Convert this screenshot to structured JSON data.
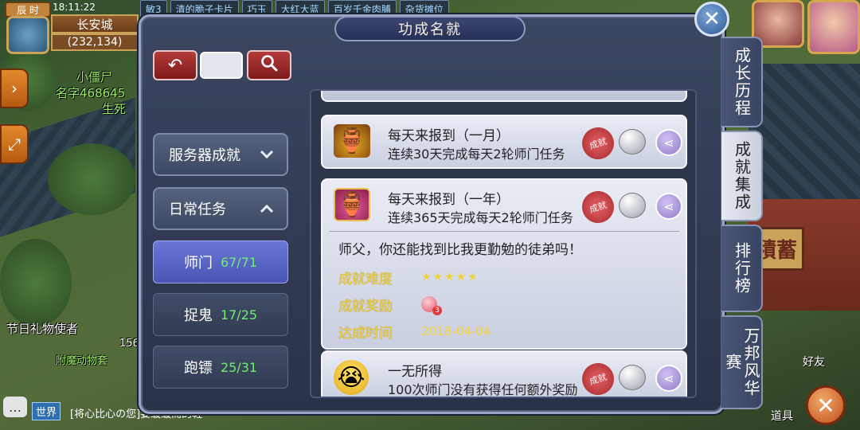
{
  "hud": {
    "time_label": "辰 时",
    "clock": "18:11:22",
    "map_name": "长安城",
    "coords": "(232,134)",
    "top_strip": [
      "敏3",
      "清的脆子卡片",
      "巧玉",
      "大红大蓝",
      "百岁千金肉脯",
      "杂货摊位"
    ]
  },
  "world": {
    "npc_small_zombie": "小僵尸",
    "npc_name_prefix": "名字468645",
    "npc_misc": "生死",
    "npc_gift": "节日礼物使者",
    "npc_pet": "附魔动物套",
    "npc_156": "156",
    "building_sign": "積蓄",
    "friend_label": "好友",
    "tool_label": "道具",
    "chat_world": "世界",
    "chat_text": "[将心比心の您]要缓缓而的鞋"
  },
  "dialog": {
    "title": "功成名就",
    "close_label": "✕",
    "back_icon": "↶",
    "search_icon": "🔍",
    "search_placeholder": ""
  },
  "sidebar": {
    "groups": [
      {
        "label": "服务器成就",
        "chevron": "⌄"
      },
      {
        "label": "日常任务",
        "chevron": "⌃"
      }
    ],
    "items": [
      {
        "label": "师门",
        "count": "67/71",
        "active": true
      },
      {
        "label": "捉鬼",
        "count": "17/25",
        "active": false
      },
      {
        "label": "跑镖",
        "count": "25/31",
        "active": false
      }
    ]
  },
  "achievements": [
    {
      "title": "每天来报到（一月）",
      "desc": "连续30天完成每天2轮师门任务",
      "icon": "urn-icon"
    },
    {
      "title": "每天来报到（一年）",
      "desc": "连续365天完成每天2轮师门任务",
      "icon": "urn-pink-icon",
      "expanded": true,
      "quote": "师父，你还能找到比我更勤勉的徒弟吗！",
      "difficulty_label": "成就难度",
      "difficulty_value": "★★★★★",
      "reward_label": "成就奖励",
      "reward_count": "3",
      "date_label": "达成时间",
      "date_value": "2018-04-04"
    },
    {
      "title": "一无所得",
      "desc": "100次师门没有获得任何额外奖励",
      "icon": "crying-face-icon"
    }
  ],
  "tabs": [
    {
      "label": "成长历程",
      "active": false
    },
    {
      "label": "成就集成",
      "active": true
    },
    {
      "label": "排行榜",
      "active": false
    },
    {
      "label": "万邦风华赛",
      "active": false
    }
  ],
  "colors": {
    "active_item": "#5a66c8",
    "count_green": "#6eee6e",
    "reward_yellow": "#f2d23a",
    "close_blue": "#2f5a94"
  }
}
